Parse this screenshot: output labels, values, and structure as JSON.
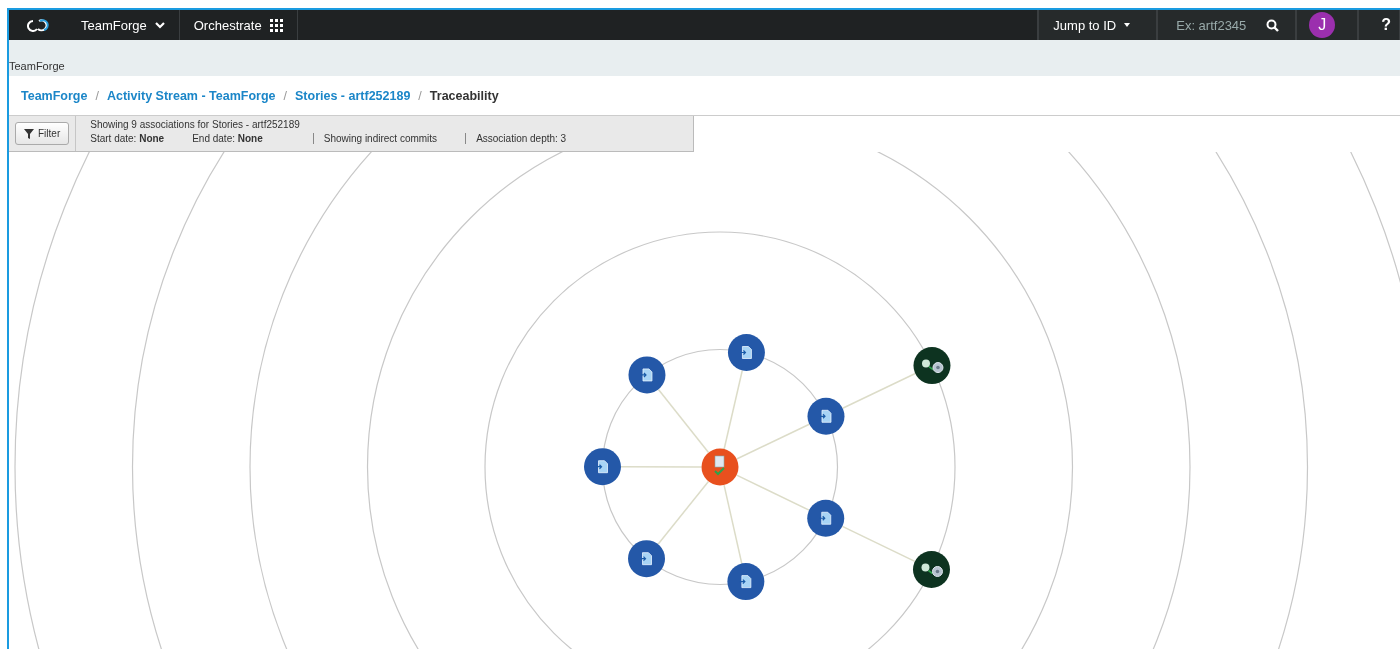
{
  "top_bar": {
    "app_menu": "TeamForge",
    "orchestrate": "Orchestrate",
    "jump_to": "Jump to ID",
    "search": {
      "placeholder": "Ex: artf2345"
    },
    "avatar": "J",
    "help": "?"
  },
  "project_label": "TeamForge",
  "breadcrumbs": [
    {
      "kind": "crumb",
      "label": "TeamForge",
      "link": true
    },
    {
      "kind": "separator",
      "label": "/"
    },
    {
      "kind": "crumb",
      "label": "Activity Stream - TeamForge",
      "link": true
    },
    {
      "kind": "separator",
      "label": "/"
    },
    {
      "kind": "crumb",
      "label": "Stories - artf252189",
      "link": true
    },
    {
      "kind": "separator",
      "label": "/"
    },
    {
      "kind": "crumb",
      "label": "Traceability",
      "link": false
    }
  ],
  "filter_bar": {
    "button": "Filter",
    "summary": "Showing 9 associations for Stories - artf252189",
    "start_label": "Start date:",
    "start_value": "None",
    "end_label": "End date:",
    "end_value": "None",
    "commits": "Showing indirect commits",
    "depth": "Association depth: 3"
  },
  "graph": {
    "root": {
      "kind": "story",
      "children": [
        {
          "kind": "artifact"
        },
        {
          "kind": "artifact",
          "children": [
            {
              "kind": "commit"
            }
          ]
        },
        {
          "kind": "artifact",
          "children": [
            {
              "kind": "commit"
            }
          ]
        },
        {
          "kind": "artifact"
        },
        {
          "kind": "artifact"
        },
        {
          "kind": "artifact"
        },
        {
          "kind": "artifact"
        }
      ]
    }
  }
}
